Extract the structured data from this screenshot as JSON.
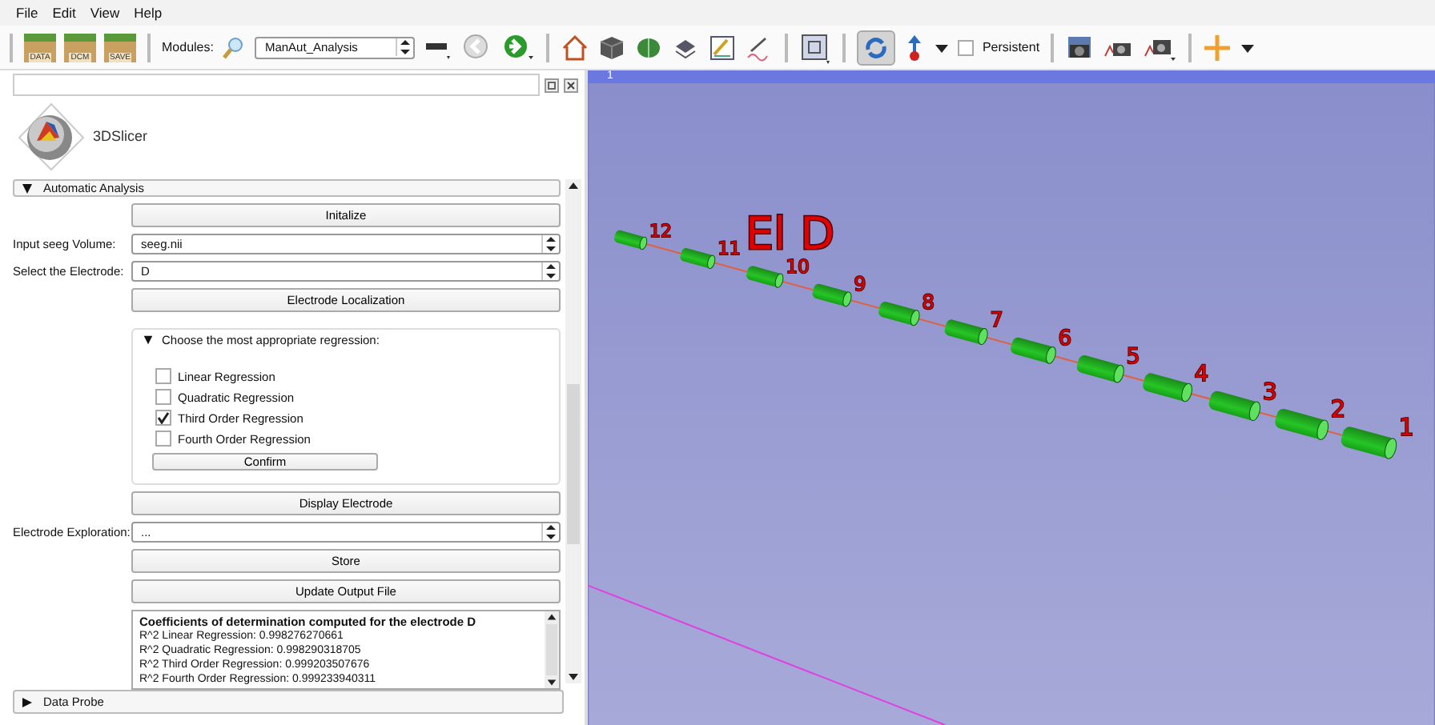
{
  "menu": [
    "File",
    "Edit",
    "View",
    "Help"
  ],
  "toolbar": {
    "load_buttons": [
      "DATA",
      "DCM",
      "SAVE"
    ],
    "modules_label": "Modules:",
    "module": "ManAut_Analysis",
    "sync_pressed": true,
    "persistent": {
      "label": "Persistent",
      "checked": false
    }
  },
  "panel": {
    "logo_text": "3DSlicer",
    "section": {
      "title": "Automatic Analysis",
      "expanded": true
    },
    "initialize_button": "Initalize",
    "volume": {
      "label": "Input seeg Volume:",
      "value": "seeg.nii"
    },
    "electrode": {
      "label": "Select the Electrode:",
      "value": "D"
    },
    "localization_button": "Electrode Localization",
    "regression": {
      "title": "Choose the most appropriate regression:",
      "expanded": true,
      "options": [
        {
          "label": "Linear Regression",
          "checked": false
        },
        {
          "label": "Quadratic Regression",
          "checked": false
        },
        {
          "label": "Third Order Regression",
          "checked": true
        },
        {
          "label": "Fourth Order Regression",
          "checked": false
        }
      ],
      "confirm_button": "Confirm"
    },
    "display_button": "Display Electrode",
    "exploration": {
      "label": "Electrode Exploration:",
      "value": "..."
    },
    "store_button": "Store",
    "update_button": "Update Output File",
    "results": {
      "heading": "Coefficients of determination computed for the electrode D",
      "lines": [
        "R^2 Linear Regression: 0.998276270661",
        "R^2 Quadratic Regression: 0.998290318705",
        "R^2 Third Order Regression: 0.999203507676",
        "R^2 Fourth Order Regression: 0.999233940311"
      ]
    },
    "data_probe": {
      "title": "Data Probe",
      "expanded": false
    }
  },
  "view": {
    "number": "1",
    "electrode_name": "El D",
    "contacts": [
      "1",
      "2",
      "3",
      "4",
      "5",
      "6",
      "7",
      "8",
      "9",
      "10",
      "11",
      "12"
    ]
  }
}
